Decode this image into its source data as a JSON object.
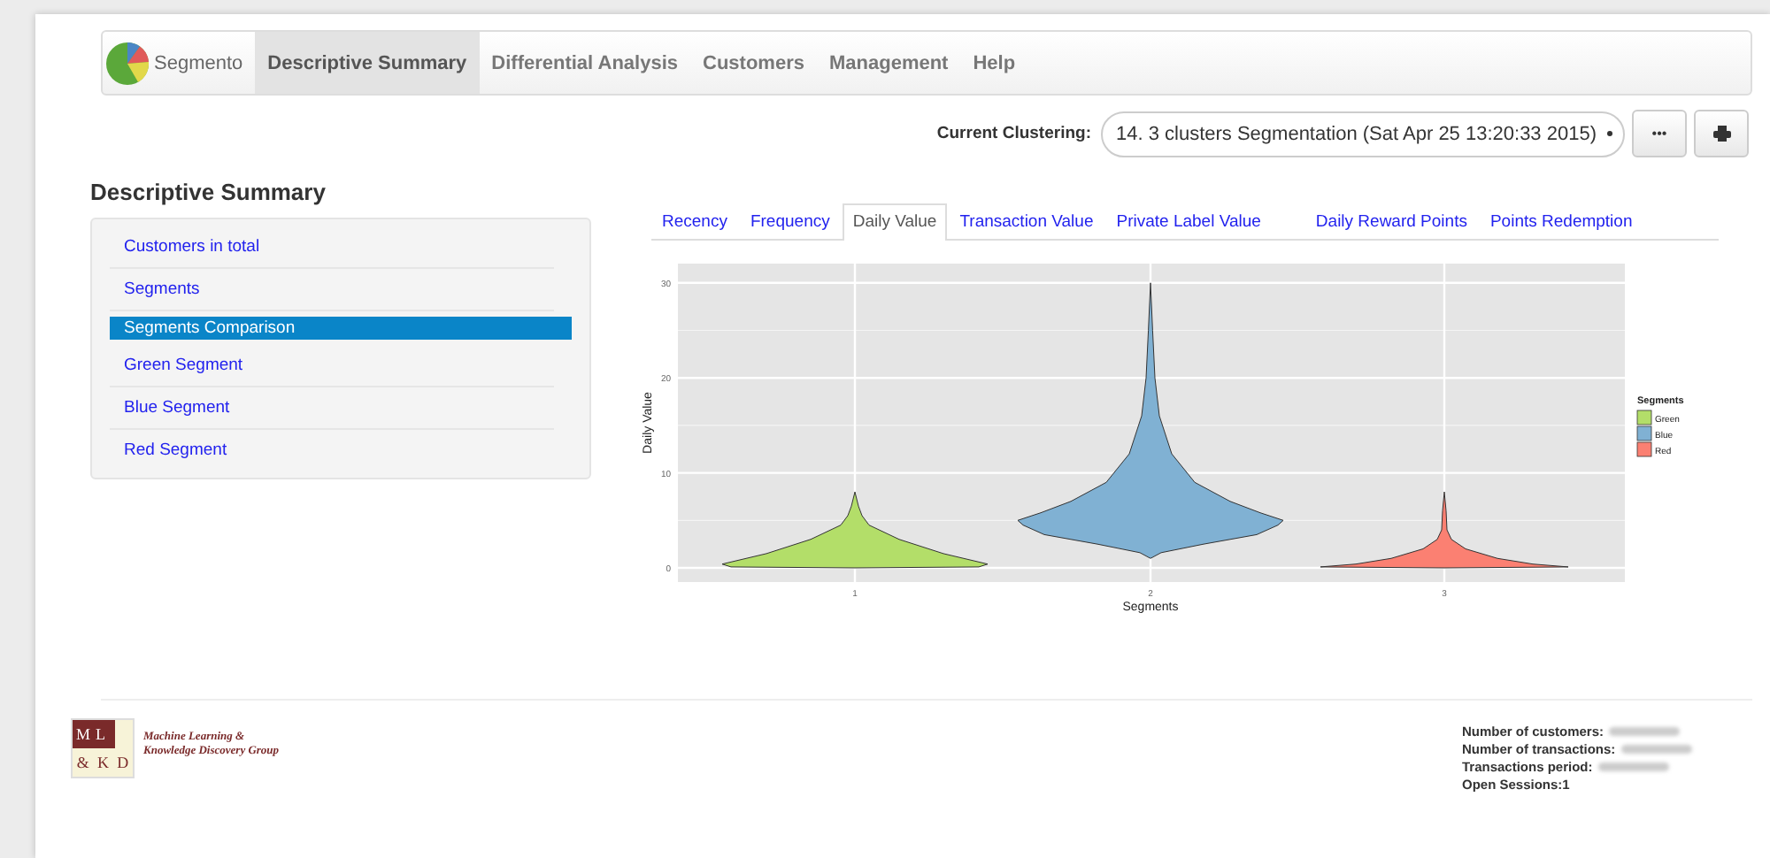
{
  "navbar": {
    "brand": "Segmento",
    "items": [
      {
        "label": "Descriptive Summary",
        "selected": true
      },
      {
        "label": "Differential Analysis",
        "selected": false
      },
      {
        "label": "Customers",
        "selected": false
      },
      {
        "label": "Management",
        "selected": false
      },
      {
        "label": "Help",
        "selected": false
      }
    ]
  },
  "clustering": {
    "label": "Current Clustering:",
    "value": "14. 3 clusters Segmentation (Sat Apr 25 13:20:33 2015)",
    "more_button": "•••"
  },
  "page_title": "Descriptive Summary",
  "sidebar": {
    "items": [
      {
        "label": "Customers in total",
        "selected": false
      },
      {
        "label": "Segments",
        "selected": false
      },
      {
        "label": "Segments Comparison",
        "selected": true
      },
      {
        "label": "Green Segment",
        "selected": false
      },
      {
        "label": "Blue Segment",
        "selected": false
      },
      {
        "label": "Red Segment",
        "selected": false
      }
    ]
  },
  "tabs": [
    {
      "label": "Recency",
      "selected": false
    },
    {
      "label": "Frequency",
      "selected": false
    },
    {
      "label": "Daily Value",
      "selected": true
    },
    {
      "label": "Transaction Value",
      "selected": false
    },
    {
      "label": "Private Label Value",
      "selected": false
    },
    {
      "label": "Daily Reward Points",
      "selected": false
    },
    {
      "label": "Points Redemption",
      "selected": false
    }
  ],
  "plot": {
    "ylabel": "Daily Value",
    "xlabel": "Segments",
    "yticks": [
      "30",
      "20",
      "10",
      "0"
    ],
    "xticks": [
      "1",
      "2",
      "3"
    ],
    "legend": {
      "title": "Segments",
      "items": [
        {
          "label": "Green",
          "color": "#b3de69"
        },
        {
          "label": "Blue",
          "color": "#80b1d3"
        },
        {
          "label": "Red",
          "color": "#fb8072"
        }
      ]
    }
  },
  "footer": {
    "logo_letters": [
      "M",
      "L",
      "&",
      "K",
      "D"
    ],
    "logo_text": [
      "Machine Learning &",
      "Knowledge Discovery Group"
    ],
    "stats": [
      {
        "label": "Number of customers:",
        "blurred": true
      },
      {
        "label": "Number of transactions:",
        "blurred": true
      },
      {
        "label": "Transactions period:",
        "blurred": true
      },
      {
        "label": "Open Sessions:1",
        "blurred": false
      }
    ]
  }
}
